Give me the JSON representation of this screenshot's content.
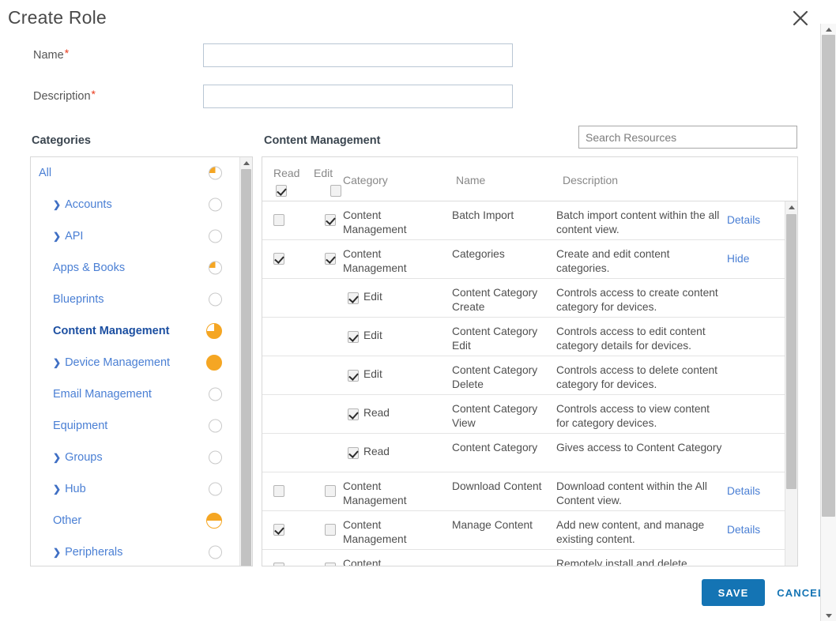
{
  "dialog": {
    "title": "Create Role",
    "close_icon": "close-icon"
  },
  "form": {
    "name_label": "Name",
    "name_required": "*",
    "name_value": "",
    "name_placeholder": "",
    "description_label": "Description",
    "description_required": "*",
    "description_value": "",
    "description_placeholder": ""
  },
  "sections": {
    "categories_heading": "Categories",
    "resources_heading": "Content Management"
  },
  "search": {
    "value": "",
    "placeholder": "Search Resources"
  },
  "categories": {
    "items": [
      {
        "label": "All",
        "expandable": false,
        "indent": false,
        "selected": false,
        "fill": 25,
        "size": "small"
      },
      {
        "label": "Accounts",
        "expandable": true,
        "indent": true,
        "selected": false,
        "fill": 0,
        "size": "small"
      },
      {
        "label": "API",
        "expandable": true,
        "indent": true,
        "selected": false,
        "fill": 0,
        "size": "small"
      },
      {
        "label": "Apps & Books",
        "expandable": false,
        "indent": true,
        "selected": false,
        "fill": 25,
        "size": "small"
      },
      {
        "label": "Blueprints",
        "expandable": false,
        "indent": true,
        "selected": false,
        "fill": 0,
        "size": "small"
      },
      {
        "label": "Content Management",
        "expandable": false,
        "indent": true,
        "selected": true,
        "fill": 75,
        "size": "big"
      },
      {
        "label": "Device Management",
        "expandable": true,
        "indent": true,
        "selected": false,
        "fill": 100,
        "size": "big"
      },
      {
        "label": "Email Management",
        "expandable": false,
        "indent": true,
        "selected": false,
        "fill": 0,
        "size": "small"
      },
      {
        "label": "Equipment",
        "expandable": false,
        "indent": true,
        "selected": false,
        "fill": 0,
        "size": "small"
      },
      {
        "label": "Groups",
        "expandable": true,
        "indent": true,
        "selected": false,
        "fill": 0,
        "size": "small"
      },
      {
        "label": "Hub",
        "expandable": true,
        "indent": true,
        "selected": false,
        "fill": 0,
        "size": "small"
      },
      {
        "label": "Other",
        "expandable": false,
        "indent": true,
        "selected": false,
        "fill": 50,
        "size": "big"
      },
      {
        "label": "Peripherals",
        "expandable": true,
        "indent": true,
        "selected": false,
        "fill": 0,
        "size": "small"
      }
    ],
    "caret_icon": "chevron-right-icon"
  },
  "resource_table": {
    "columns": {
      "read": "Read",
      "edit": "Edit",
      "category": "Category",
      "name": "Name",
      "description": "Description"
    },
    "header_read_checked": true,
    "header_edit_checked": false,
    "rows": [
      {
        "type": "main",
        "read": false,
        "edit": true,
        "category": "Content Management",
        "name": "Batch Import",
        "description": "Batch import content within the all content view.",
        "link": "Details"
      },
      {
        "type": "main",
        "read": true,
        "edit": true,
        "category": "Content Management",
        "name": "Categories",
        "description": "Create and edit content categories.",
        "link": "Hide"
      },
      {
        "type": "sub",
        "sub_checked": true,
        "sub_label": "Edit",
        "name": "Content Category Create",
        "description": "Controls access to create content category for devices.",
        "link": ""
      },
      {
        "type": "sub",
        "sub_checked": true,
        "sub_label": "Edit",
        "name": "Content Category Edit",
        "description": "Controls access to edit content category details for devices.",
        "link": ""
      },
      {
        "type": "sub",
        "sub_checked": true,
        "sub_label": "Edit",
        "name": "Content Category Delete",
        "description": "Controls access to delete content category for devices.",
        "link": ""
      },
      {
        "type": "sub",
        "sub_checked": true,
        "sub_label": "Read",
        "name": "Content Category View",
        "description": "Controls access to view content for category devices.",
        "link": ""
      },
      {
        "type": "sub",
        "sub_checked": true,
        "sub_label": "Read",
        "name": "Content Category",
        "description": "Gives access to Content Category",
        "link": ""
      },
      {
        "type": "main",
        "read": false,
        "edit": false,
        "category": "Content Management",
        "name": "Download Content",
        "description": "Download content within the All Content view.",
        "link": "Details"
      },
      {
        "type": "main",
        "read": true,
        "edit": false,
        "category": "Content Management",
        "name": "Manage Content",
        "description": "Add new content, and manage existing content.",
        "link": "Details"
      },
      {
        "type": "main",
        "read": false,
        "edit": false,
        "category": "Content",
        "name": "",
        "description": "Remotely install and delete",
        "link": ""
      }
    ]
  },
  "footer": {
    "save_label": "SAVE",
    "cancel_label": "CANCEL"
  },
  "colors": {
    "accent_blue": "#1474b4",
    "link_blue": "#4a7fd4",
    "orange": "#f5a623",
    "required_red": "#e8391b"
  }
}
